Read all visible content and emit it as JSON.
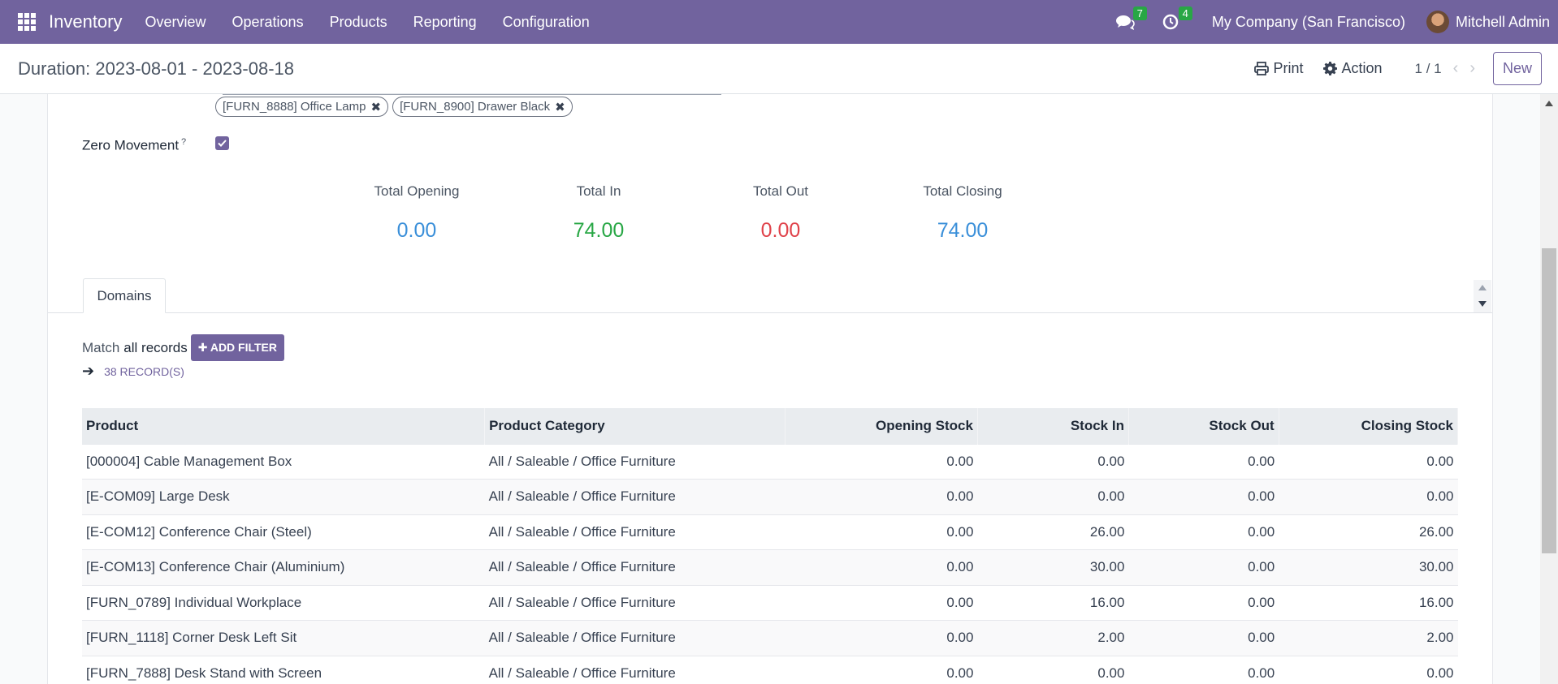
{
  "navbar": {
    "app_name": "Inventory",
    "menu": [
      "Overview",
      "Operations",
      "Products",
      "Reporting",
      "Configuration"
    ],
    "messages_badge": "7",
    "activities_badge": "4",
    "company": "My Company (San Francisco)",
    "user": "Mitchell Admin",
    "accent_color": "#71639e"
  },
  "control": {
    "title": "Duration: 2023-08-01 - 2023-08-18",
    "print_label": "Print",
    "action_label": "Action",
    "pager": "1 / 1",
    "new_label": "New"
  },
  "form": {
    "product_tags": [
      "[FURN_8888] Office Lamp",
      "[FURN_8900] Drawer Black"
    ],
    "zero_movement_label": "Zero Movement",
    "zero_movement_help": "?",
    "zero_movement_checked": true,
    "totals": [
      {
        "label": "Total Opening",
        "value": "0.00",
        "color": "#3a8fd9"
      },
      {
        "label": "Total In",
        "value": "74.00",
        "color": "#28a745"
      },
      {
        "label": "Total Out",
        "value": "0.00",
        "color": "#e0424a"
      },
      {
        "label": "Total Closing",
        "value": "74.00",
        "color": "#3a8fd9"
      }
    ],
    "tab_label": "Domains",
    "match_prefix": "Match",
    "match_scope": "all records",
    "add_filter_label": "ADD FILTER",
    "records_label": "38 RECORD(S)"
  },
  "table": {
    "columns": [
      "Product",
      "Product Category",
      "Opening Stock",
      "Stock In",
      "Stock Out",
      "Closing Stock"
    ],
    "rows": [
      [
        "[000004] Cable Management Box",
        "All / Saleable / Office Furniture",
        "0.00",
        "0.00",
        "0.00",
        "0.00"
      ],
      [
        "[E-COM09] Large Desk",
        "All / Saleable / Office Furniture",
        "0.00",
        "0.00",
        "0.00",
        "0.00"
      ],
      [
        "[E-COM12] Conference Chair (Steel)",
        "All / Saleable / Office Furniture",
        "0.00",
        "26.00",
        "0.00",
        "26.00"
      ],
      [
        "[E-COM13] Conference Chair (Aluminium)",
        "All / Saleable / Office Furniture",
        "0.00",
        "30.00",
        "0.00",
        "30.00"
      ],
      [
        "[FURN_0789] Individual Workplace",
        "All / Saleable / Office Furniture",
        "0.00",
        "16.00",
        "0.00",
        "16.00"
      ],
      [
        "[FURN_1118] Corner Desk Left Sit",
        "All / Saleable / Office Furniture",
        "0.00",
        "2.00",
        "0.00",
        "2.00"
      ],
      [
        "[FURN_7888] Desk Stand with Screen",
        "All / Saleable / Office Furniture",
        "0.00",
        "0.00",
        "0.00",
        "0.00"
      ]
    ]
  }
}
